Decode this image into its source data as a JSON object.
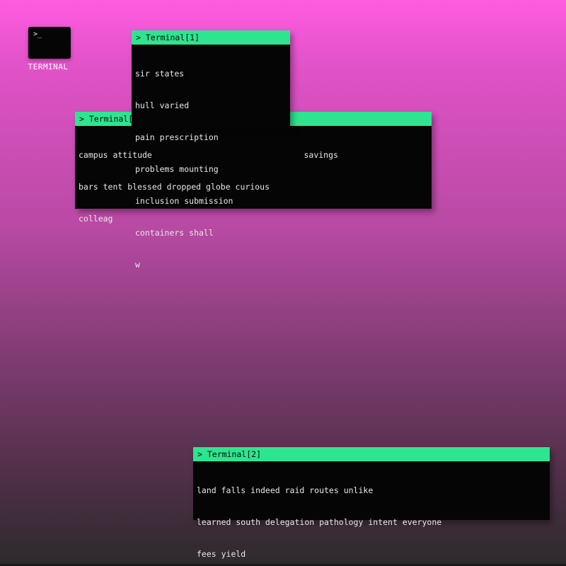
{
  "desktop": {
    "icon_prompt": ">_",
    "icon_label": "TERMINAL"
  },
  "windows": [
    {
      "title": "> Terminal[0]",
      "lines": [
        "campus attitude                               savings",
        "bars tent blessed dropped globe curious",
        "colleag"
      ]
    },
    {
      "title": "> Terminal[1]",
      "lines": [
        "sir states",
        "hull varied",
        "pain prescription",
        "problems mounting",
        "inclusion submission",
        "containers shall",
        "w"
      ]
    },
    {
      "title": "> Terminal[2]",
      "lines": [
        "land falls indeed raid routes unlike",
        "learned south delegation pathology intent everyone",
        "fees yield"
      ]
    }
  ],
  "colors": {
    "titlebar": "#2ee58f",
    "window_bg": "#050505",
    "gradient_top": "#ff5ce0",
    "gradient_bottom": "#2c2a2c"
  }
}
